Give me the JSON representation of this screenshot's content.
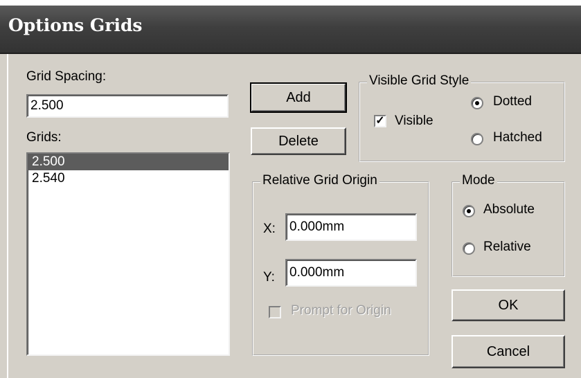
{
  "window": {
    "title": "Options Grids"
  },
  "grid_spacing": {
    "label": "Grid Spacing:",
    "value": "2.500"
  },
  "grids": {
    "label": "Grids:",
    "items": [
      "2.500",
      "2.540"
    ],
    "selected_index": 0
  },
  "buttons": {
    "add": "Add",
    "delete": "Delete",
    "ok": "OK",
    "cancel": "Cancel"
  },
  "visible_grid_style": {
    "legend": "Visible Grid Style",
    "visible_label": "Visible",
    "visible_checked": true,
    "dotted_label": "Dotted",
    "hatched_label": "Hatched",
    "selected": "Dotted"
  },
  "relative_origin": {
    "legend": "Relative Grid Origin",
    "x_label": "X:",
    "x_value": "0.000mm",
    "y_label": "Y:",
    "y_value": "0.000mm",
    "prompt_label": "Prompt for Origin",
    "prompt_enabled": false
  },
  "mode": {
    "legend": "Mode",
    "absolute_label": "Absolute",
    "relative_label": "Relative",
    "selected": "Absolute"
  }
}
